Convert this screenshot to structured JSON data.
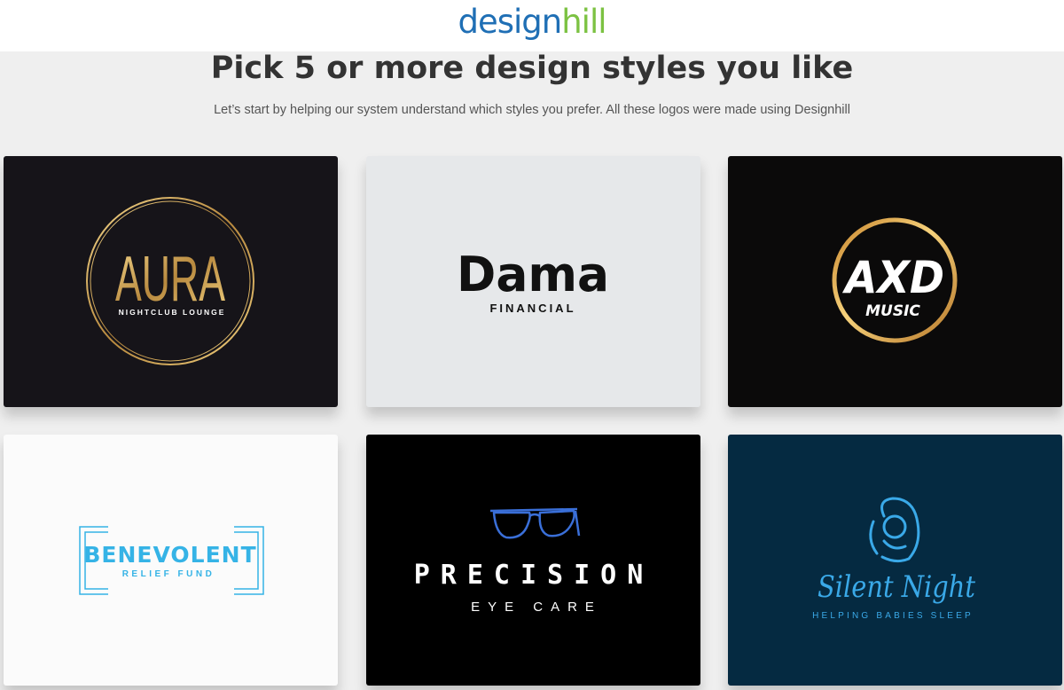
{
  "header": {
    "brand_part1": "design",
    "brand_part2": "hill",
    "colors": {
      "brand_blue": "#1f6fb5",
      "brand_green": "#7cc242"
    }
  },
  "main": {
    "title": "Pick 5 or more design styles you like",
    "subtitle": "Let’s start by helping our system understand which styles you prefer. All these logos were made using Designhill"
  },
  "cards": [
    {
      "name": "AURA",
      "tagline": "NIGHTCLUB LOUNGE",
      "background": "#161419",
      "accent": "#d4af6a"
    },
    {
      "name": "Dama",
      "tagline": "FINANCIAL",
      "background": "#e6e8ea",
      "accent": "#111111"
    },
    {
      "name": "AXD",
      "tagline": "MUSIC",
      "background": "#0b0a0a",
      "accent": "#d8a24a"
    },
    {
      "name": "BENEVOLENT",
      "tagline": "RELIEF FUND",
      "background": "#fbfbfb",
      "accent": "#35b3e6"
    },
    {
      "name": "PRECISION",
      "tagline": "EYE CARE",
      "background": "#000000",
      "accent": "#3a6fd8"
    },
    {
      "name": "Silent Night",
      "tagline": "HELPING BABIES SLEEP",
      "background": "#052a41",
      "accent": "#3aa9e8"
    }
  ],
  "icons": [
    "ring-icon",
    "gradient-circle-icon",
    "corner-brackets-icon",
    "glasses-icon",
    "mother-baby-icon"
  ]
}
